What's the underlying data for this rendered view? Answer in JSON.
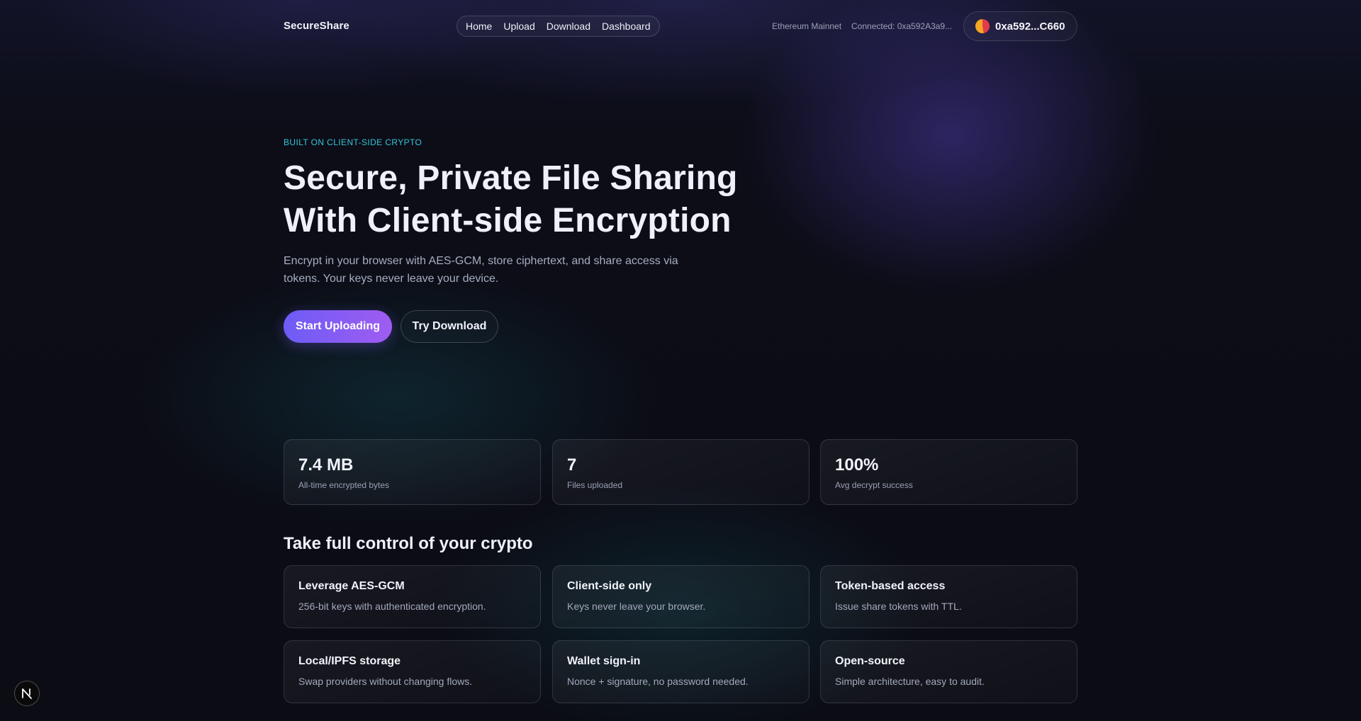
{
  "header": {
    "brand": "SecureShare",
    "nav": [
      "Home",
      "Upload",
      "Download",
      "Dashboard"
    ],
    "network": "Ethereum Mainnet",
    "connected": "Connected: 0xa592A3a9...",
    "wallet_address": "0xa592...C660"
  },
  "hero": {
    "eyebrow": "BUILT ON CLIENT-SIDE CRYPTO",
    "title_line1": "Secure, Private File Sharing",
    "title_line2": "With Client-side Encryption",
    "subtitle": "Encrypt in your browser with AES-GCM, store ciphertext, and share access via tokens. Your keys never leave your device.",
    "primary_button": "Start Uploading",
    "secondary_button": "Try Download"
  },
  "stats": [
    {
      "value": "7.4 MB",
      "label": "All-time encrypted bytes"
    },
    {
      "value": "7",
      "label": "Files uploaded"
    },
    {
      "value": "100%",
      "label": "Avg decrypt success"
    }
  ],
  "features_section": {
    "title": "Take full control of your crypto",
    "items": [
      {
        "title": "Leverage AES-GCM",
        "desc": "256-bit keys with authenticated encryption."
      },
      {
        "title": "Client-side only",
        "desc": "Keys never leave your browser."
      },
      {
        "title": "Token-based access",
        "desc": "Issue share tokens with TTL."
      },
      {
        "title": "Local/IPFS storage",
        "desc": "Swap providers without changing flows."
      },
      {
        "title": "Wallet sign-in",
        "desc": "Nonce + signature, no password needed."
      },
      {
        "title": "Open-source",
        "desc": "Simple architecture, easy to audit."
      }
    ]
  },
  "colors": {
    "accent_cyan": "#35c6d8",
    "button_gradient_start": "#6d5cf5",
    "button_gradient_end": "#9f5cf2",
    "background": "#0b0c14"
  },
  "icons": {
    "wallet_avatar": "wallet-avatar-icon",
    "dev_badge": "nextjs-logo-icon"
  }
}
